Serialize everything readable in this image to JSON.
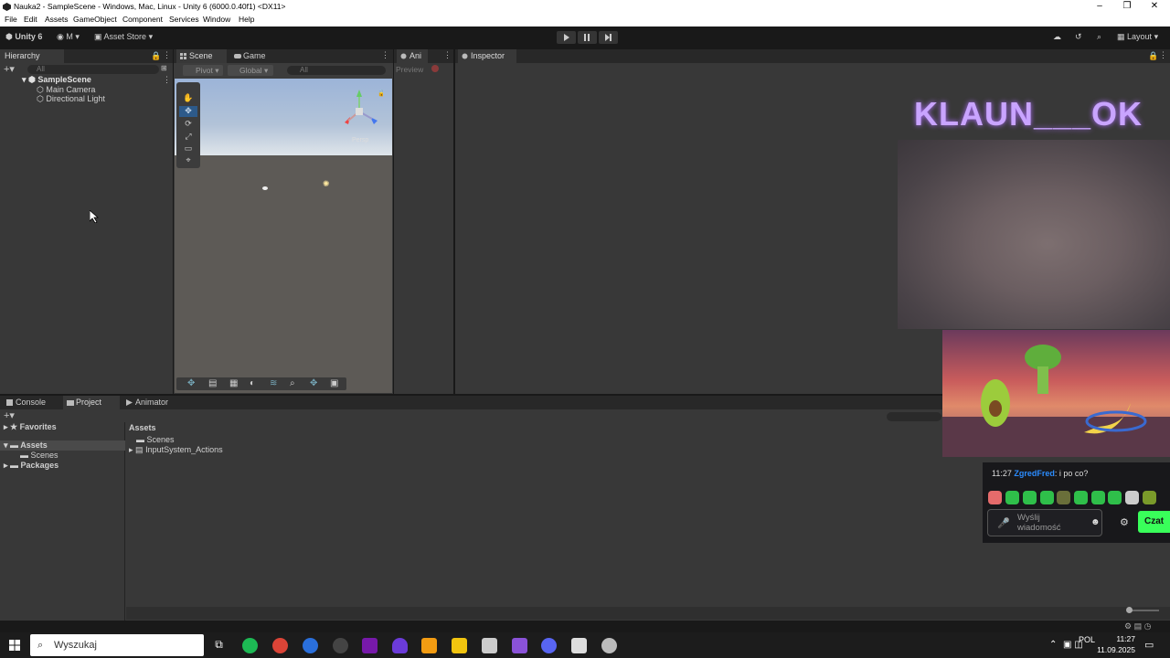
{
  "window": {
    "title": "Nauka2 - SampleScene - Windows, Mac, Linux - Unity 6 (6000.0.40f1) <DX11>"
  },
  "menu": [
    "File",
    "Edit",
    "Assets",
    "GameObject",
    "Component",
    "Services",
    "Window",
    "Help"
  ],
  "toolbar": {
    "unity_label": "Unity 6",
    "account": "M",
    "asset_store": "Asset Store",
    "layout": "Layout"
  },
  "hierarchy": {
    "tab": "Hierarchy",
    "search": "All",
    "scene": "SampleScene",
    "items": [
      "Main Camera",
      "Directional Light"
    ]
  },
  "scene": {
    "tabs": [
      "Scene",
      "Game"
    ],
    "pivot": "Pivot",
    "global": "Global",
    "search": "All",
    "persp": "Persp"
  },
  "animation": {
    "tab": "Ani",
    "preview": "Preview"
  },
  "inspector": {
    "tab": "Inspector"
  },
  "bottom": {
    "tabs": [
      "Console",
      "Project",
      "Animator"
    ],
    "favorites": "Favorites",
    "assets": "Assets",
    "scenes": "Scenes",
    "packages": "Packages",
    "crumb": "Assets",
    "folders": [
      "Scenes",
      "InputSystem_Actions"
    ]
  },
  "stream": {
    "title": "KLAUN___OK",
    "chat_time": "11:27",
    "chat_user": "ZgredFred",
    "chat_msg": ": i po co?",
    "input_placeholder": "Wyślij wiadomość",
    "send": "Czat"
  },
  "taskbar": {
    "search": "Wyszukaj",
    "lang": "POL",
    "time": "11:27",
    "date": "11.09.2025"
  },
  "colors": {
    "stream_title": "#c9a4ff",
    "chat_user": "#2b8cff",
    "czat_button": "#39ff5a"
  }
}
